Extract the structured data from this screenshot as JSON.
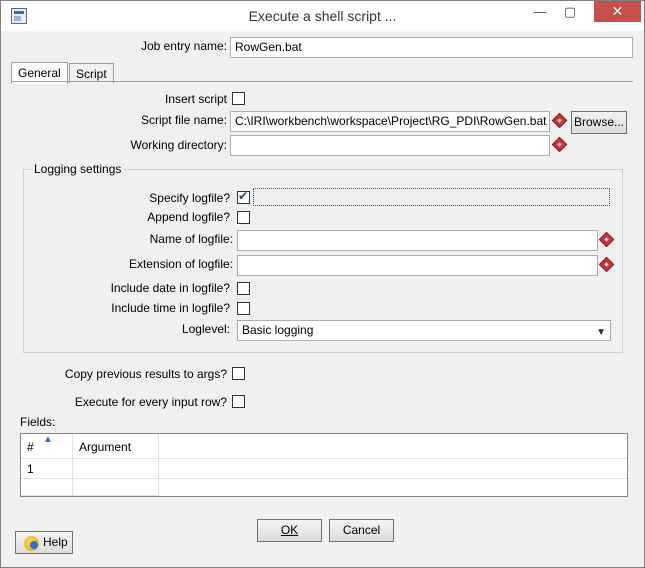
{
  "window": {
    "title": "Execute a shell script ...",
    "controls": {
      "minimize": "—",
      "maximize": "▢",
      "close": "✕"
    }
  },
  "job_entry": {
    "label": "Job entry name:",
    "value": "RowGen.bat"
  },
  "tabs": [
    {
      "label": "General",
      "active": true
    },
    {
      "label": "Script",
      "active": false
    }
  ],
  "general": {
    "insert_script": {
      "label": "Insert script",
      "checked": false
    },
    "script_file": {
      "label": "Script file name:",
      "value": "C:\\IRI\\workbench\\workspace\\Project\\RG_PDI\\RowGen.bat"
    },
    "browse_button": "Browse...",
    "working_dir": {
      "label": "Working directory:",
      "value": ""
    }
  },
  "logging": {
    "group_title": "Logging settings",
    "specify_logfile": {
      "label": "Specify logfile?",
      "checked": true
    },
    "append_logfile": {
      "label": "Append logfile?",
      "checked": false
    },
    "name_of_logfile": {
      "label": "Name of logfile:",
      "value": ""
    },
    "extension_of_logfile": {
      "label": "Extension of logfile:",
      "value": ""
    },
    "include_date": {
      "label": "Include date in logfile?",
      "checked": false
    },
    "include_time": {
      "label": "Include time in logfile?",
      "checked": false
    },
    "loglevel": {
      "label": "Loglevel:",
      "selected": "Basic logging"
    }
  },
  "copy_previous": {
    "label": "Copy previous results to args?",
    "checked": false
  },
  "execute_every_row": {
    "label": "Execute for every input row?",
    "checked": false
  },
  "fields": {
    "label": "Fields:",
    "columns": [
      "#",
      "Argument"
    ],
    "rows": [
      {
        "num": "1",
        "argument": ""
      }
    ]
  },
  "buttons": {
    "ok": "OK",
    "cancel": "Cancel",
    "help": "Help"
  },
  "icons": {
    "app": "shell-script-icon",
    "variable": "variable-diamond-icon",
    "help": "help-icon"
  }
}
